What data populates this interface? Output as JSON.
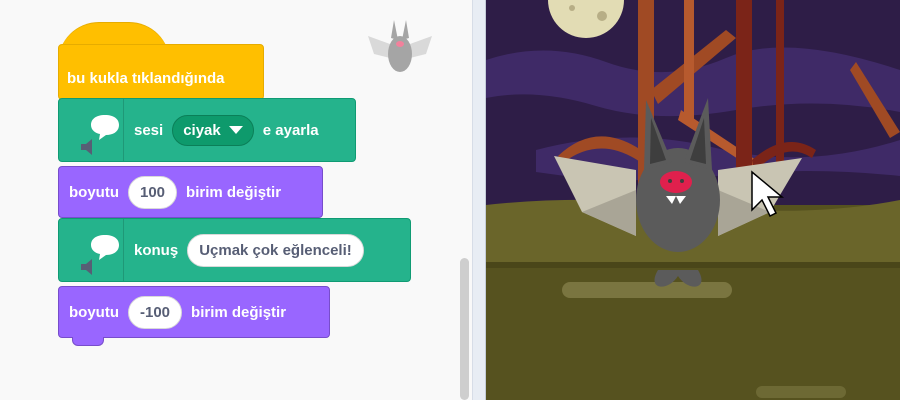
{
  "code_area": {
    "hat_block": {
      "label": "bu kukla tıklandığında"
    },
    "sound_block": {
      "prefix": "sesi",
      "dropdown_value": "ciyak",
      "suffix": "e ayarla"
    },
    "size_block_1": {
      "prefix": "boyutu",
      "value": "100",
      "suffix": "birim değiştir"
    },
    "say_block": {
      "prefix": "konuş",
      "value": "Uçmak çok eğlenceli!"
    },
    "size_block_2": {
      "prefix": "boyutu",
      "value": "-100",
      "suffix": "birim değiştir"
    }
  },
  "colors": {
    "events": "#ffbf00",
    "extension": "#25b38c",
    "looks": "#9966ff",
    "stage_sky": "#2e1d47"
  },
  "icons": [
    "speech-bubble-icon",
    "speaker-icon",
    "dropdown-caret-icon",
    "mouse-cursor-icon"
  ]
}
